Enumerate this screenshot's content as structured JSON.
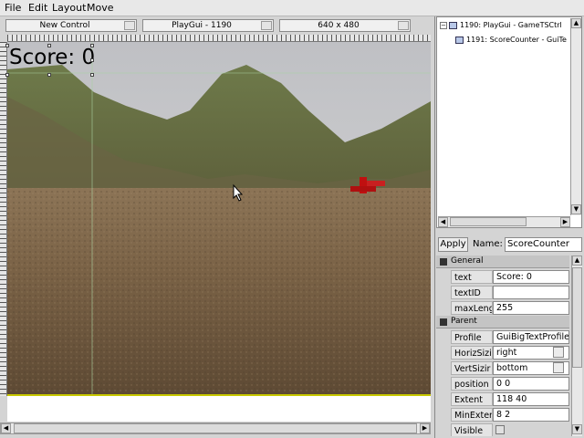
{
  "menu": [
    "File",
    "Edit",
    "Layout",
    "Move"
  ],
  "toolbar": {
    "new_control": "New Control",
    "gui_select": "PlayGui - 1190",
    "resolution": "640 x 480"
  },
  "canvas": {
    "score_text": "Score: 0"
  },
  "tree": {
    "root": "1190: PlayGui - GameTSCtrl",
    "child": "1191: ScoreCounter - GuiTe"
  },
  "inspector": {
    "apply_label": "Apply",
    "name_label": "Name:",
    "name_value": "ScoreCounter",
    "sections": {
      "general": "General",
      "parent": "Parent"
    },
    "general_props": [
      {
        "label": "text",
        "value": "Score: 0"
      },
      {
        "label": "textID",
        "value": ""
      },
      {
        "label": "maxLeng",
        "value": "255"
      }
    ],
    "parent_props": [
      {
        "label": "Profile",
        "value": "GuiBigTextProfile"
      },
      {
        "label": "HorizSizi",
        "value": "right"
      },
      {
        "label": "VertSizir",
        "value": "bottom"
      },
      {
        "label": "position",
        "value": "0 0"
      },
      {
        "label": "Extent",
        "value": "118 40"
      },
      {
        "label": "MinExter",
        "value": "8 2"
      },
      {
        "label": "Visible",
        "value": ""
      }
    ]
  },
  "icons": {
    "cursor": "mouse-pointer-icon",
    "tree_node": "gui-control-icon"
  },
  "colors": {
    "sky": "#c8c8cc",
    "ground": "#7a6448",
    "hills": "#5e6a3a",
    "marker": "#c01010",
    "guide": "#c8c800"
  }
}
